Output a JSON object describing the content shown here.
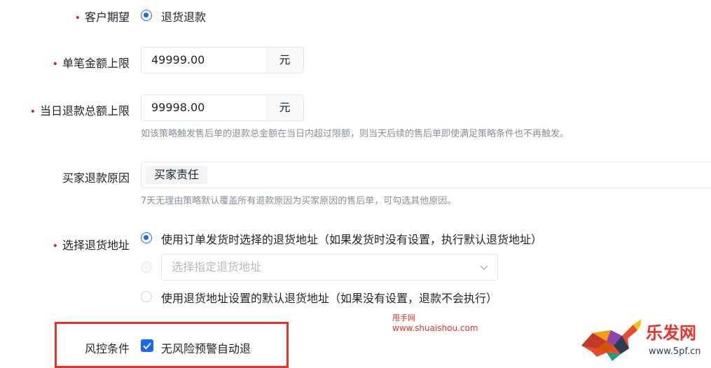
{
  "fields": {
    "expectation": {
      "label": "客户期望",
      "option": "退货退款"
    },
    "single_limit": {
      "label": "单笔金额上限",
      "value": "49999.00",
      "unit": "元"
    },
    "daily_limit": {
      "label": "当日退款总额上限",
      "value": "99998.00",
      "unit": "元",
      "hint": "如该策略触发售后单的退款总金额在当日内超过限额，则当天后续的售后单即使满足策略条件也不再触发。"
    },
    "refund_reason": {
      "label": "买家退款原因",
      "tag": "买家责任",
      "hint": "7天无理由策略默认覆盖所有退款原因为买家原因的售后单，可勾选其他原因。"
    },
    "return_address": {
      "label": "选择退货地址",
      "option1": "使用订单发货时选择的退货地址（如果发货时没有设置，执行默认退货地址）",
      "select_placeholder": "选择指定退货地址",
      "option3": "使用退货地址设置的默认退货地址（如果没有设置，退款不会执行）"
    },
    "risk": {
      "label": "风控条件",
      "checkbox": "无风险预警自动退"
    }
  },
  "watermark": {
    "line1": "甩手网",
    "line2": "www.shuaishou.com",
    "logo_text": "乐发网",
    "logo_url": "www.5pf.cn"
  },
  "colors": {
    "primary": "#1966ff",
    "required": "#e02020",
    "highlight": "#e8322a"
  }
}
